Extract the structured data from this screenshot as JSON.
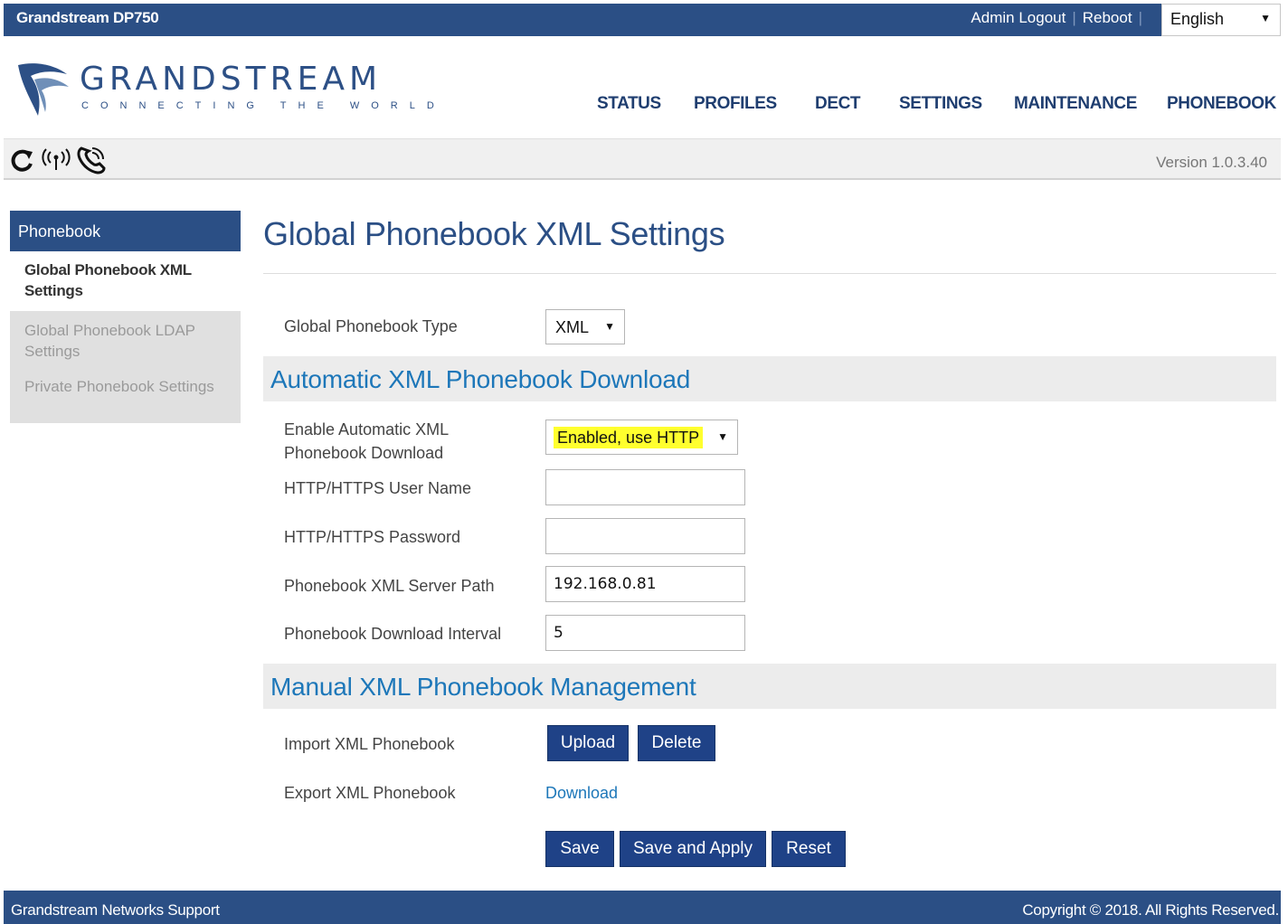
{
  "topbar": {
    "brand": "Grandstream DP750",
    "admin_logout": "Admin Logout",
    "separator": "|",
    "reboot": "Reboot",
    "language": "English"
  },
  "logo": {
    "word": "GRANDSTREAM",
    "tagline": "CONNECTING THE WORLD"
  },
  "nav": [
    "STATUS",
    "PROFILES",
    "DECT",
    "SETTINGS",
    "MAINTENANCE",
    "PHONEBOOK"
  ],
  "toolbar": {
    "icons": [
      "refresh-icon",
      "wireless-signal-icon",
      "phone-call-icon"
    ],
    "version": "Version 1.0.3.40"
  },
  "sidebar": {
    "header": "Phonebook",
    "items": [
      {
        "label": "Global Phonebook XML Settings",
        "active": true
      },
      {
        "label": "Global Phonebook LDAP Settings",
        "active": false
      },
      {
        "label": "Private Phonebook Settings",
        "active": false
      }
    ]
  },
  "main": {
    "title": "Global Phonebook XML Settings",
    "phonebook_type": {
      "label": "Global Phonebook Type",
      "value": "XML"
    },
    "auto_section": "Automatic XML Phonebook Download",
    "enable_auto": {
      "label": "Enable Automatic XML Phonebook Download",
      "value": "Enabled, use HTTP"
    },
    "username": {
      "label": "HTTP/HTTPS User Name",
      "value": ""
    },
    "password": {
      "label": "HTTP/HTTPS Password",
      "value": ""
    },
    "server_path": {
      "label": "Phonebook XML Server Path",
      "value": "192.168.0.81"
    },
    "interval": {
      "label": "Phonebook Download Interval",
      "value": "5"
    },
    "manual_section": "Manual XML Phonebook Management",
    "import": {
      "label": "Import XML Phonebook",
      "upload": "Upload",
      "delete": "Delete"
    },
    "export": {
      "label": "Export XML Phonebook",
      "download": "Download"
    },
    "actions": {
      "save": "Save",
      "save_apply": "Save and Apply",
      "reset": "Reset"
    }
  },
  "footer": {
    "support": "Grandstream Networks Support",
    "copyright": "Copyright © 2018. All Rights Reserved."
  },
  "colors": {
    "header_blue": "#2b4f85",
    "button_blue": "#1f4287",
    "link_blue": "#1d77b9",
    "highlight_yellow": "#ffff2e"
  }
}
